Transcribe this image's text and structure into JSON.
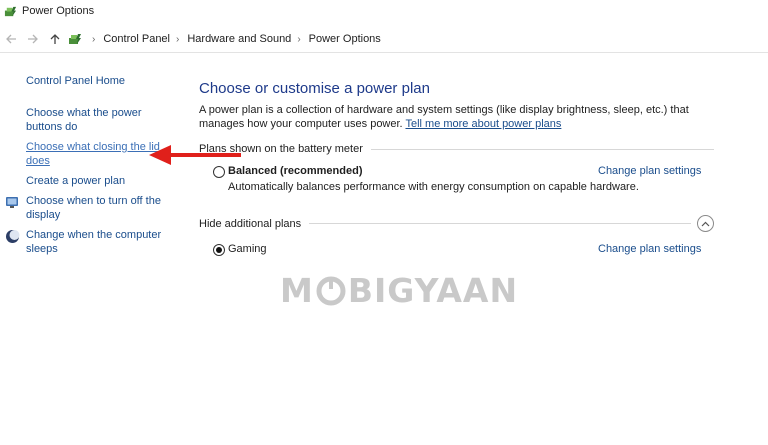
{
  "window": {
    "title": "Power Options"
  },
  "address": {
    "breadcrumbs": [
      "Control Panel",
      "Hardware and Sound",
      "Power Options"
    ]
  },
  "sidebar": {
    "home": "Control Panel Home",
    "links": [
      {
        "label": "Choose what the power buttons do",
        "icon": null
      },
      {
        "label": "Choose what closing the lid does",
        "icon": null
      },
      {
        "label": "Create a power plan",
        "icon": null
      },
      {
        "label": "Choose when to turn off the display",
        "icon": "monitor-shield-icon"
      },
      {
        "label": "Change when the computer sleeps",
        "icon": "moon-icon"
      }
    ]
  },
  "main": {
    "title": "Choose or customise a power plan",
    "description": "A power plan is a collection of hardware and system settings (like display brightness, sleep, etc.) that manages how your computer uses power.",
    "tell_more_link": "Tell me more about power plans",
    "battery_section": "Plans shown on the battery meter",
    "hidden_section": "Hide additional plans",
    "plans": [
      {
        "name": "Balanced (recommended)",
        "description": "Automatically balances performance with energy consumption on capable hardware.",
        "change_link": "Change plan settings",
        "selected": false
      },
      {
        "name": "Gaming",
        "description": "",
        "change_link": "Change plan settings",
        "selected": true
      }
    ]
  },
  "watermark": {
    "left": "M",
    "right": "BIGYAAN"
  },
  "colors": {
    "link": "#1a4d8c",
    "title": "#1e3a8a",
    "arrow": "#e0201b",
    "watermark": "#c9c9c9"
  }
}
